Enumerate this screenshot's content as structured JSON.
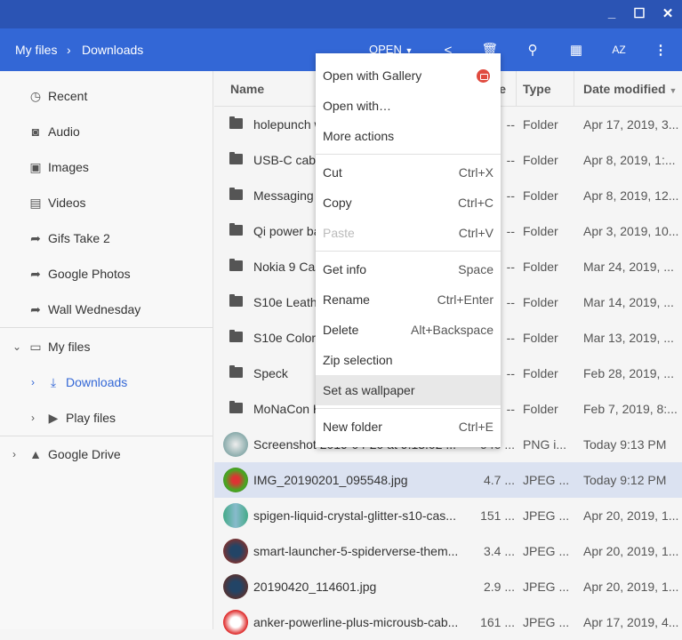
{
  "window": {
    "minimize": "_",
    "maximize": "☐",
    "close": "✕"
  },
  "breadcrumb": {
    "root": "My files",
    "separator": "›",
    "current": "Downloads"
  },
  "toolbar": {
    "open_label": "OPEN",
    "accent": "#3367d6"
  },
  "sidebar": {
    "items": [
      {
        "label": "Recent",
        "icon": "clock-icon"
      },
      {
        "label": "Audio",
        "icon": "headphones-icon"
      },
      {
        "label": "Images",
        "icon": "image-icon"
      },
      {
        "label": "Videos",
        "icon": "film-icon"
      },
      {
        "label": "Gifs Take 2",
        "icon": "shortcut-icon"
      },
      {
        "label": "Google Photos",
        "icon": "shortcut-icon"
      },
      {
        "label": "Wall Wednesday",
        "icon": "shortcut-icon"
      }
    ],
    "my_files": "My files",
    "downloads": "Downloads",
    "play_files": "Play files",
    "google_drive": "Google Drive"
  },
  "table": {
    "headers": {
      "name": "Name",
      "size": "Size",
      "type": "Type",
      "date": "Date modified"
    },
    "rows": [
      {
        "name": "holepunch w",
        "size": "--",
        "type": "Folder",
        "date": "Apr 17, 2019, 3..."
      },
      {
        "name": "USB-C cable",
        "size": "--",
        "type": "Folder",
        "date": "Apr 8, 2019, 1:..."
      },
      {
        "name": "Messaging",
        "size": "--",
        "type": "Folder",
        "date": "Apr 8, 2019, 12..."
      },
      {
        "name": "Qi power ba",
        "size": "--",
        "type": "Folder",
        "date": "Apr 3, 2019, 10..."
      },
      {
        "name": "Nokia 9 Cas",
        "size": "--",
        "type": "Folder",
        "date": "Mar 24, 2019, ..."
      },
      {
        "name": "S10e Leath",
        "size": "--",
        "type": "Folder",
        "date": "Mar 14, 2019, ..."
      },
      {
        "name": "S10e Colorf",
        "size": "--",
        "type": "Folder",
        "date": "Mar 13, 2019, ..."
      },
      {
        "name": "Speck",
        "size": "--",
        "type": "Folder",
        "date": "Feb 28, 2019, ..."
      },
      {
        "name": "MoNaCon H",
        "size": "--",
        "type": "Folder",
        "date": "Feb 7, 2019, 8:..."
      },
      {
        "name": "Screenshot 2019-04-20 at 9.13.02 ...",
        "size": "946 ...",
        "type": "PNG i...",
        "date": "Today 9:13 PM"
      },
      {
        "name": "IMG_20190201_095548.jpg",
        "size": "4.7 ...",
        "type": "JPEG ...",
        "date": "Today 9:12 PM"
      },
      {
        "name": "spigen-liquid-crystal-glitter-s10-cas...",
        "size": "151 ...",
        "type": "JPEG ...",
        "date": "Apr 20, 2019, 1..."
      },
      {
        "name": "smart-launcher-5-spiderverse-them...",
        "size": "3.4 ...",
        "type": "JPEG ...",
        "date": "Apr 20, 2019, 1..."
      },
      {
        "name": "20190420_114601.jpg",
        "size": "2.9 ...",
        "type": "JPEG ...",
        "date": "Apr 20, 2019, 1..."
      },
      {
        "name": "anker-powerline-plus-microusb-cab...",
        "size": "161 ...",
        "type": "JPEG ...",
        "date": "Apr 17, 2019, 4..."
      }
    ]
  },
  "menu": {
    "open_gallery": "Open with Gallery",
    "open_with": "Open with…",
    "more_actions": "More actions",
    "cut": "Cut",
    "cut_sc": "Ctrl+X",
    "copy": "Copy",
    "copy_sc": "Ctrl+C",
    "paste": "Paste",
    "paste_sc": "Ctrl+V",
    "get_info": "Get info",
    "get_info_sc": "Space",
    "rename": "Rename",
    "rename_sc": "Ctrl+Enter",
    "delete": "Delete",
    "delete_sc": "Alt+Backspace",
    "zip": "Zip selection",
    "wallpaper": "Set as wallpaper",
    "new_folder": "New folder",
    "new_folder_sc": "Ctrl+E"
  }
}
